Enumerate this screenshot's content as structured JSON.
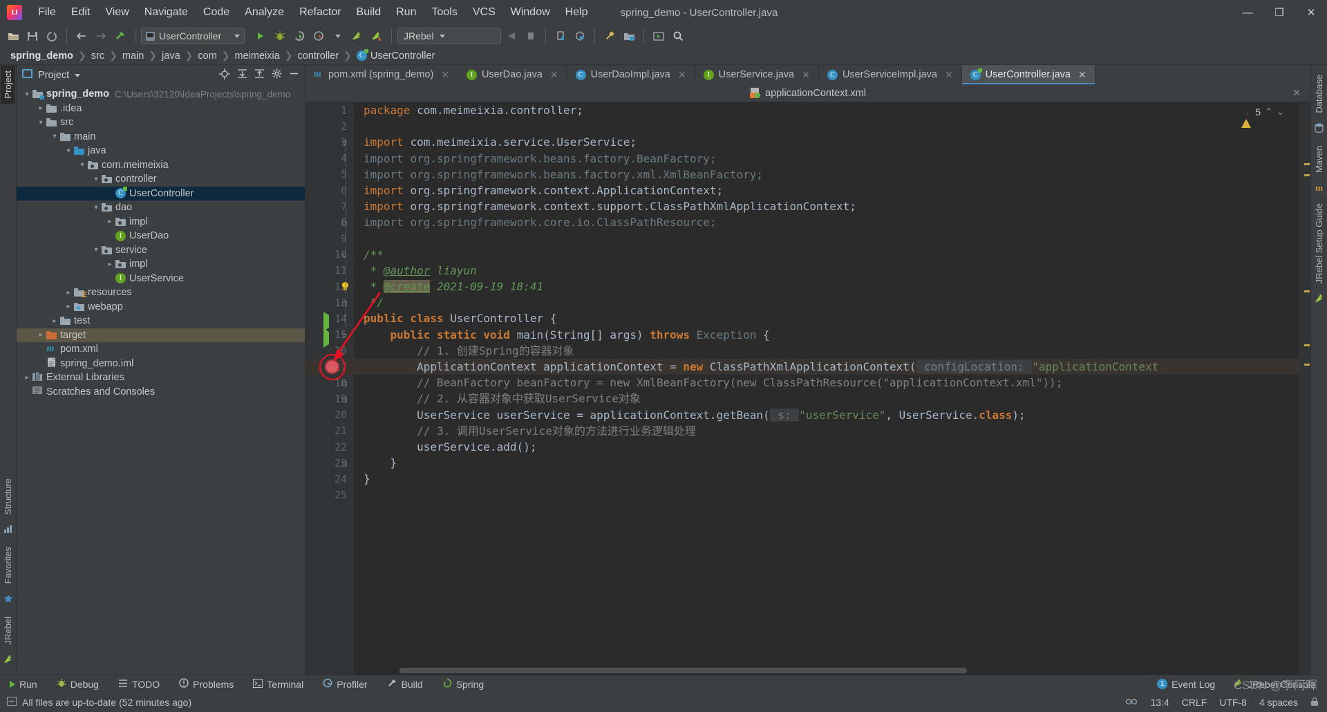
{
  "window": {
    "title": "spring_demo - UserController.java",
    "minimize": "—",
    "maximize": "❐",
    "close": "✕"
  },
  "menu": [
    {
      "label": "File"
    },
    {
      "label": "Edit"
    },
    {
      "label": "View"
    },
    {
      "label": "Navigate"
    },
    {
      "label": "Code"
    },
    {
      "label": "Analyze"
    },
    {
      "label": "Refactor"
    },
    {
      "label": "Build"
    },
    {
      "label": "Run"
    },
    {
      "label": "Tools"
    },
    {
      "label": "VCS"
    },
    {
      "label": "Window"
    },
    {
      "label": "Help"
    }
  ],
  "toolbar": {
    "run_config": "UserController",
    "jrebel": "JRebel",
    "icons": [
      "open-icon",
      "save-icon",
      "sync-icon",
      "back-icon",
      "forward-icon",
      "build-icon",
      "run-icon",
      "debug-icon",
      "run-coverage-icon",
      "profiler-icon",
      "jrebel-run-icon",
      "jrebel-debug-icon",
      "stop-icon",
      "square-icon",
      "device-icon",
      "apk-icon",
      "settings-wrench-icon",
      "project-structure-icon",
      "run-anything-icon",
      "search-everywhere-icon"
    ]
  },
  "breadcrumb": [
    {
      "label": "spring_demo",
      "bold": true
    },
    {
      "label": "src",
      "bold": false
    },
    {
      "label": "main",
      "bold": false
    },
    {
      "label": "java",
      "bold": false
    },
    {
      "label": "com",
      "bold": false
    },
    {
      "label": "meimeixia",
      "bold": false
    },
    {
      "label": "controller",
      "bold": false
    },
    {
      "label": "UserController",
      "bold": false,
      "icon": "class-icon"
    }
  ],
  "left_strip": {
    "project_tab": "Project",
    "structure_tab": "Structure",
    "favorites_tab": "Favorites",
    "jrebel_tab": "JRebel"
  },
  "right_strip": {
    "database_tab": "Database",
    "maven_tab": "Maven",
    "jrebel_setup_tab": "JRebel Setup Guide"
  },
  "project_panel": {
    "title": "Project",
    "actions": [
      "locate-icon",
      "expand-all-icon",
      "collapse-all-icon",
      "settings-gear-icon",
      "hide-icon"
    ],
    "tree": [
      {
        "label": "spring_demo",
        "path": "C:\\Users\\32120\\IdeaProjects\\spring_demo",
        "depth": 0,
        "arrow": "down",
        "icon": "project-folder-icon",
        "bold": true
      },
      {
        "label": ".idea",
        "depth": 1,
        "arrow": "right",
        "icon": "folder-icon"
      },
      {
        "label": "src",
        "depth": 1,
        "arrow": "down",
        "icon": "folder-icon"
      },
      {
        "label": "main",
        "depth": 2,
        "arrow": "down",
        "icon": "folder-icon"
      },
      {
        "label": "java",
        "depth": 3,
        "arrow": "down",
        "icon": "source-folder-icon"
      },
      {
        "label": "com.meimeixia",
        "depth": 4,
        "arrow": "down",
        "icon": "package-icon"
      },
      {
        "label": "controller",
        "depth": 5,
        "arrow": "down",
        "icon": "package-icon"
      },
      {
        "label": "UserController",
        "depth": 6,
        "arrow": "none",
        "icon": "class-run-icon",
        "selected": true
      },
      {
        "label": "dao",
        "depth": 5,
        "arrow": "down",
        "icon": "package-icon"
      },
      {
        "label": "impl",
        "depth": 6,
        "arrow": "right",
        "icon": "package-icon"
      },
      {
        "label": "UserDao",
        "depth": 6,
        "arrow": "none",
        "icon": "interface-icon"
      },
      {
        "label": "service",
        "depth": 5,
        "arrow": "down",
        "icon": "package-icon"
      },
      {
        "label": "impl",
        "depth": 6,
        "arrow": "right",
        "icon": "package-icon"
      },
      {
        "label": "UserService",
        "depth": 6,
        "arrow": "none",
        "icon": "interface-icon"
      },
      {
        "label": "resources",
        "depth": 3,
        "arrow": "right",
        "icon": "resources-folder-icon"
      },
      {
        "label": "webapp",
        "depth": 3,
        "arrow": "right",
        "icon": "webapp-folder-icon"
      },
      {
        "label": "test",
        "depth": 2,
        "arrow": "right",
        "icon": "folder-icon"
      },
      {
        "label": "target",
        "depth": 1,
        "arrow": "right",
        "icon": "excluded-folder-icon",
        "highlight": true
      },
      {
        "label": "pom.xml",
        "depth": 1,
        "arrow": "none",
        "icon": "maven-icon"
      },
      {
        "label": "spring_demo.iml",
        "depth": 1,
        "arrow": "none",
        "icon": "iml-icon"
      },
      {
        "label": "External Libraries",
        "depth": 0,
        "arrow": "right",
        "icon": "libraries-icon"
      },
      {
        "label": "Scratches and Consoles",
        "depth": 0,
        "arrow": "none",
        "icon": "scratches-icon"
      }
    ]
  },
  "editor_tabs": [
    {
      "label": "pom.xml (spring_demo)",
      "icon": "maven-icon",
      "active": false
    },
    {
      "label": "UserDao.java",
      "icon": "interface-icon",
      "active": false
    },
    {
      "label": "UserDaoImpl.java",
      "icon": "class-icon",
      "active": false
    },
    {
      "label": "UserService.java",
      "icon": "interface-icon",
      "active": false
    },
    {
      "label": "UserServiceImpl.java",
      "icon": "class-icon",
      "active": false
    },
    {
      "label": "UserController.java",
      "icon": "class-icon",
      "active": true
    }
  ],
  "xml_bar": {
    "label": "applicationContext.xml",
    "close": "✕"
  },
  "inspection": {
    "count": "5",
    "chevron_up": "⌃",
    "chevron_down": "⌄"
  },
  "code": {
    "line_count": 25,
    "current_line": 17,
    "breakpoint_line": 17,
    "lines": [
      {
        "n": 1,
        "segments": [
          {
            "t": "package ",
            "c": "kw"
          },
          {
            "t": "com.meimeixia.controller;",
            "c": "ident"
          }
        ]
      },
      {
        "n": 2,
        "segments": []
      },
      {
        "n": 3,
        "fold": "open",
        "segments": [
          {
            "t": "import ",
            "c": "kw"
          },
          {
            "t": "com.meimeixia.service.UserService;",
            "c": "ident"
          }
        ]
      },
      {
        "n": 4,
        "segments": [
          {
            "t": "import ",
            "c": "gray"
          },
          {
            "t": "org.springframework.beans.factory.BeanFactory;",
            "c": "gray"
          }
        ]
      },
      {
        "n": 5,
        "segments": [
          {
            "t": "import ",
            "c": "gray"
          },
          {
            "t": "org.springframework.beans.factory.xml.XmlBeanFactory;",
            "c": "gray"
          }
        ]
      },
      {
        "n": 6,
        "segments": [
          {
            "t": "import ",
            "c": "kw"
          },
          {
            "t": "org.springframework.context.ApplicationContext;",
            "c": "ident"
          }
        ]
      },
      {
        "n": 7,
        "segments": [
          {
            "t": "import ",
            "c": "kw"
          },
          {
            "t": "org.springframework.context.support.ClassPathXmlApplicationContext;",
            "c": "ident"
          }
        ]
      },
      {
        "n": 8,
        "fold": "end",
        "segments": [
          {
            "t": "import ",
            "c": "gray"
          },
          {
            "t": "org.springframework.core.io.ClassPathResource;",
            "c": "gray"
          }
        ]
      },
      {
        "n": 9,
        "segments": []
      },
      {
        "n": 10,
        "fold": "open",
        "segments": [
          {
            "t": "/**",
            "c": "doc"
          }
        ]
      },
      {
        "n": 11,
        "segments": [
          {
            "t": " * ",
            "c": "doc"
          },
          {
            "t": "@author",
            "c": "doctag"
          },
          {
            "t": " liayun",
            "c": "doc"
          }
        ]
      },
      {
        "n": 12,
        "bulb": true,
        "segments": [
          {
            "t": " * ",
            "c": "doc"
          },
          {
            "t": "@create",
            "c": "doctag hl"
          },
          {
            "t": " 2021-09-19 18:41",
            "c": "doc"
          }
        ]
      },
      {
        "n": 13,
        "fold": "end",
        "segments": [
          {
            "t": " */",
            "c": "doc"
          }
        ]
      },
      {
        "n": 14,
        "gutter_run": true,
        "segments": [
          {
            "t": "public class ",
            "c": "kwb"
          },
          {
            "t": "UserController ",
            "c": "ident"
          },
          {
            "t": "{",
            "c": "ident"
          }
        ]
      },
      {
        "n": 15,
        "gutter_run": true,
        "fold": "open",
        "segments": [
          {
            "t": "    ",
            "c": "ident"
          },
          {
            "t": "public static ",
            "c": "kwb"
          },
          {
            "t": "void ",
            "c": "kwb"
          },
          {
            "t": "main",
            "c": "ident"
          },
          {
            "t": "(String[] args) ",
            "c": "ident"
          },
          {
            "t": "throws ",
            "c": "kwb"
          },
          {
            "t": "Exception ",
            "c": "gray"
          },
          {
            "t": "{",
            "c": "ident"
          }
        ]
      },
      {
        "n": 16,
        "segments": [
          {
            "t": "        // 1. 创建Spring的容器对象",
            "c": "cmt"
          }
        ]
      },
      {
        "n": 17,
        "current": true,
        "segments": [
          {
            "t": "        ApplicationContext applicationContext = ",
            "c": "ident"
          },
          {
            "t": "new ",
            "c": "kwb"
          },
          {
            "t": "ClassPathXmlApplicationContext(",
            "c": "ident"
          },
          {
            "t": " configLocation: ",
            "c": "hint"
          },
          {
            "t": "\"applicationContext",
            "c": "str"
          }
        ]
      },
      {
        "n": 18,
        "fold": "mark",
        "segments": [
          {
            "t": "        // BeanFactory beanFactory = new XmlBeanFactory(new ClassPathResource(\"applicationContext.xml\"));",
            "c": "cmt"
          }
        ]
      },
      {
        "n": 19,
        "fold": "mark",
        "segments": [
          {
            "t": "        // 2. 从容器对象中获取UserService对象",
            "c": "cmt"
          }
        ]
      },
      {
        "n": 20,
        "segments": [
          {
            "t": "        UserService userService = applicationContext.getBean(",
            "c": "ident"
          },
          {
            "t": " s: ",
            "c": "hint"
          },
          {
            "t": "\"userService\"",
            "c": "str"
          },
          {
            "t": ", UserService.",
            "c": "ident"
          },
          {
            "t": "class",
            "c": "kwb"
          },
          {
            "t": ");",
            "c": "ident"
          }
        ]
      },
      {
        "n": 21,
        "segments": [
          {
            "t": "        // 3. 调用UserService对象的方法进行业务逻辑处理",
            "c": "cmt"
          }
        ]
      },
      {
        "n": 22,
        "segments": [
          {
            "t": "        userService.add();",
            "c": "ident"
          }
        ]
      },
      {
        "n": 23,
        "fold": "end",
        "segments": [
          {
            "t": "    }",
            "c": "ident"
          }
        ]
      },
      {
        "n": 24,
        "segments": [
          {
            "t": "}",
            "c": "ident"
          }
        ]
      },
      {
        "n": 25,
        "segments": []
      }
    ]
  },
  "bottom_bar": [
    {
      "label": "Run",
      "icon": "run-icon"
    },
    {
      "label": "Debug",
      "icon": "debug-icon"
    },
    {
      "label": "TODO",
      "icon": "todo-icon"
    },
    {
      "label": "Problems",
      "icon": "problems-icon"
    },
    {
      "label": "Terminal",
      "icon": "terminal-icon"
    },
    {
      "label": "Profiler",
      "icon": "profiler-icon"
    },
    {
      "label": "Build",
      "icon": "build-icon"
    },
    {
      "label": "Spring",
      "icon": "spring-icon"
    }
  ],
  "bottom_right": [
    {
      "label": "Event Log",
      "icon": "event-log-icon",
      "badge": "1"
    },
    {
      "label": "JRebel Console",
      "icon": "jrebel-icon"
    }
  ],
  "status_bar": {
    "message": "All files are up-to-date (52 minutes ago)",
    "caret": "13:4",
    "line_sep": "CRLF",
    "encoding": "UTF-8",
    "indent": "4 spaces",
    "lock_icon": "lock-icon"
  },
  "watermark": {
    "brand": "CSDN @李阿晖"
  }
}
